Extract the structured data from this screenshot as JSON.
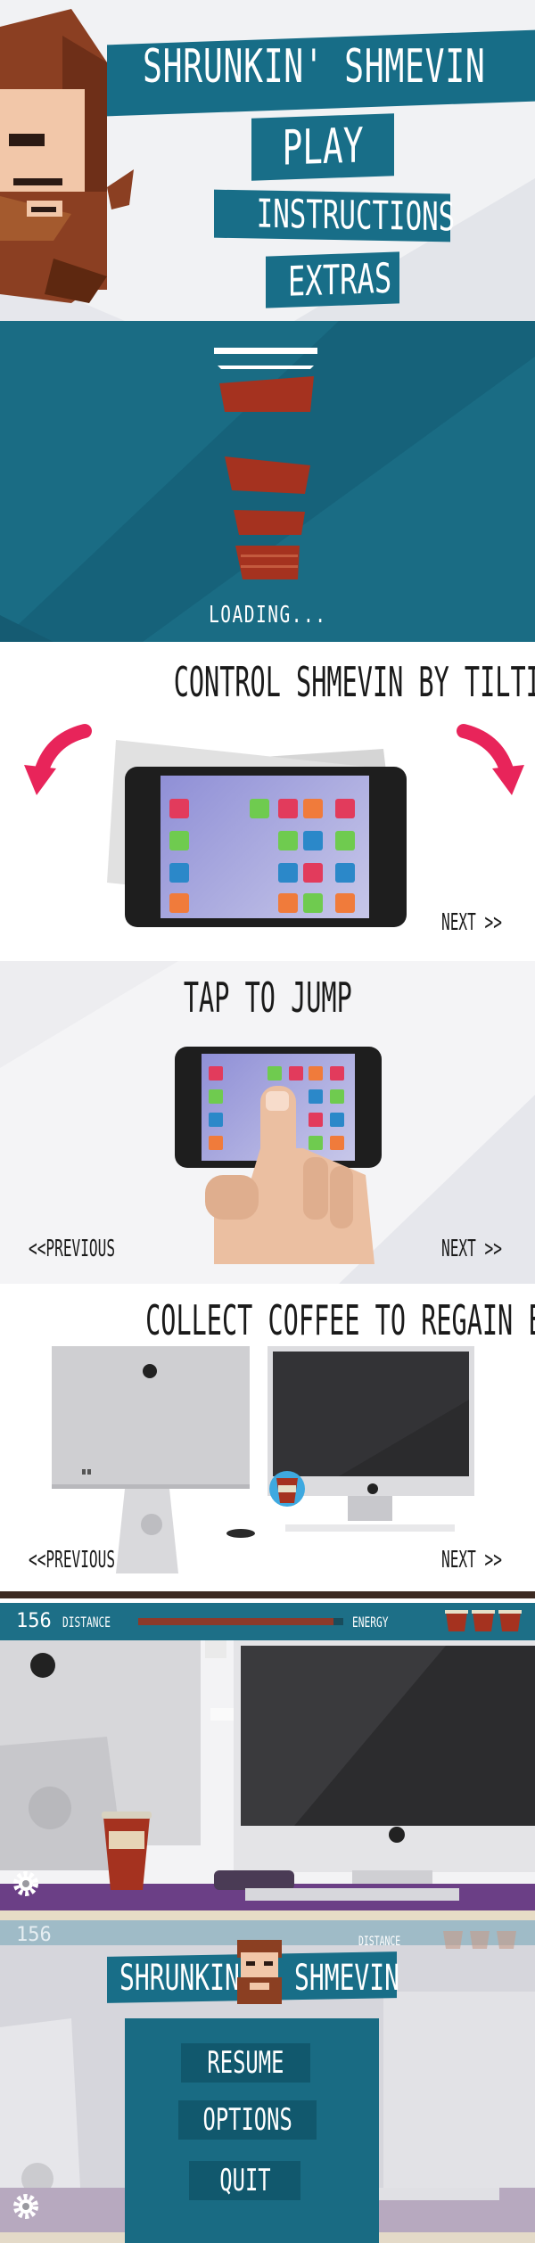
{
  "title_screen": {
    "title": "SHRUNKIN' SHMEVIN",
    "menu": [
      "PLAY",
      "INSTRUCTIONS",
      "EXTRAS"
    ]
  },
  "loading_screen": {
    "label": "LOADING..."
  },
  "instructions": {
    "tilt": {
      "heading": "CONTROL SHMEVIN BY TILTING YOUR PHONE",
      "next": "NEXT >>"
    },
    "tap": {
      "heading": "TAP TO JUMP",
      "previous": "<<PREVIOUS",
      "next": "NEXT >>"
    },
    "coffee": {
      "heading": "COLLECT COFFEE TO REGAIN ENERGY",
      "previous": "<<PREVIOUS",
      "next": "NEXT >>"
    }
  },
  "gameplay": {
    "distance_value": "156",
    "distance_label": "DISTANCE",
    "energy_label": "ENERGY",
    "energy_cups": 3,
    "energy_fraction": 0.95
  },
  "pause_screen": {
    "distance_value": "156",
    "distance_label": "DISTANCE",
    "title_left": "SHRUNKIN'",
    "title_right": "SHMEVIN",
    "menu": [
      "RESUME",
      "OPTIONS",
      "QUIT"
    ]
  },
  "colors": {
    "teal": "#186e88",
    "accent_pink": "#e8245a",
    "cup_red": "#a5321f"
  }
}
